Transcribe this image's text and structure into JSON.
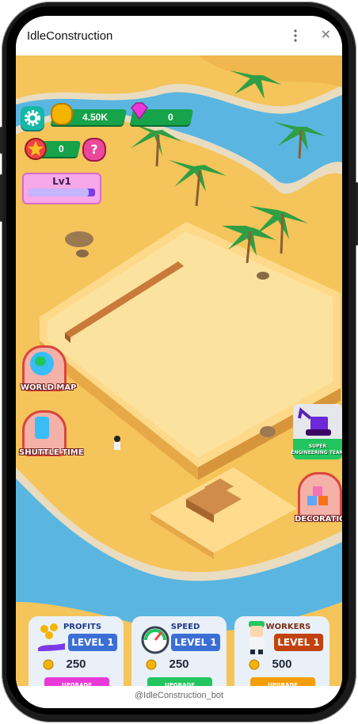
{
  "window": {
    "title": "IdleConstruction"
  },
  "footer": {
    "bot_name": "@IdleConstruction_bot"
  },
  "hud": {
    "coins": "4.50K",
    "gems": "0",
    "stars": "0",
    "help_label": "?",
    "level_label": "Lv1",
    "level_progress": 0.9
  },
  "side_buttons": {
    "world_map": "WORLD MAP",
    "shuttle_time": "SHUTTLE TIME",
    "super_team": "SUPER ENGINEERING TEAM",
    "decoration": "DECORATION"
  },
  "cards": [
    {
      "title": "PROFITS",
      "level": "LEVEL 1",
      "cost": "250",
      "button": "UPGRADE",
      "button_color": "#e83ad8"
    },
    {
      "title": "SPEED",
      "level": "LEVEL 1",
      "cost": "250",
      "button": "UPGRADE",
      "button_color": "#22c55e"
    },
    {
      "title": "WORKERS",
      "level": "LEVEL 1",
      "cost": "500",
      "button": "UPGRADE",
      "button_color": "#f59e0b"
    }
  ],
  "colors": {
    "sand": "#f5c45a",
    "water": "#5ab6e0",
    "pill": "#16a34a"
  }
}
